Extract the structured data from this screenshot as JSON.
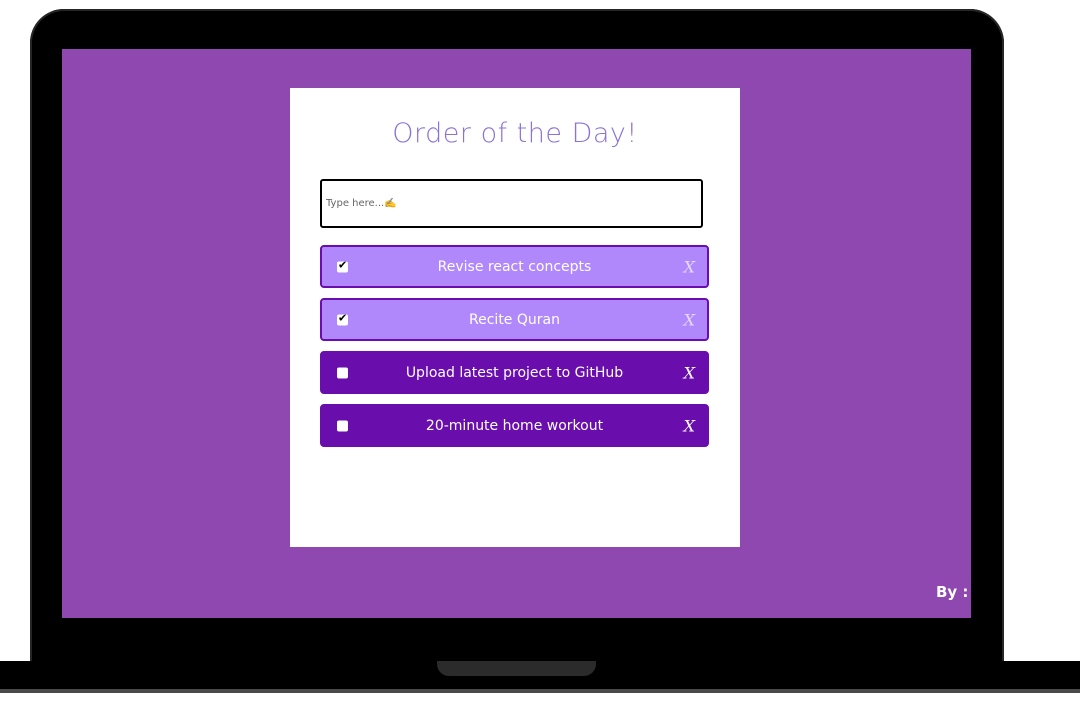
{
  "app": {
    "title": "Order of the Day!",
    "input_placeholder": "Type here...✍️",
    "input_value": ""
  },
  "todos": [
    {
      "label": "Revise react concepts",
      "done": true,
      "check_glyph": "✔",
      "delete_label": "X"
    },
    {
      "label": "Recite Quran",
      "done": true,
      "check_glyph": "✔",
      "delete_label": "X"
    },
    {
      "label": "Upload latest project to GitHub",
      "done": false,
      "check_glyph": "",
      "delete_label": "X"
    },
    {
      "label": "20-minute home workout",
      "done": false,
      "check_glyph": "",
      "delete_label": "X"
    }
  ],
  "footer": {
    "credit": "By :"
  },
  "colors": {
    "background": "#8e48b0",
    "done_item": "#b088fb",
    "todo_item": "#6a0dad",
    "title": "#8b72d6"
  }
}
